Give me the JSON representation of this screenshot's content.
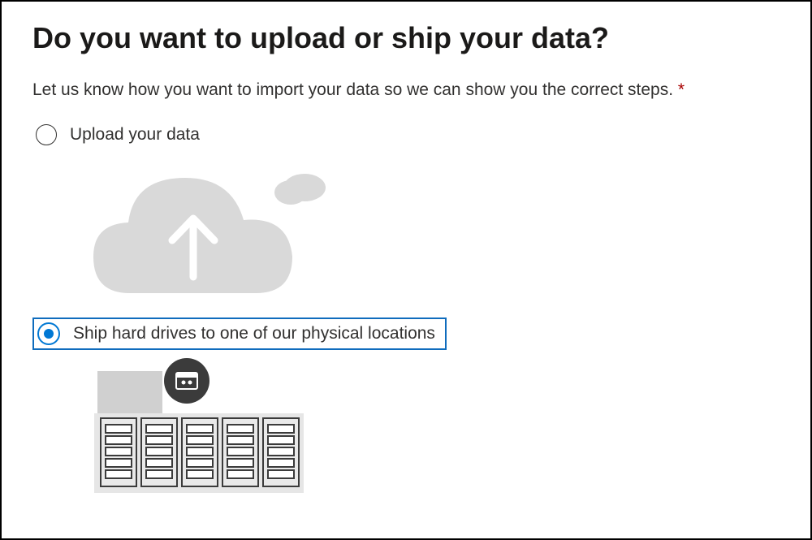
{
  "title": "Do you want to upload or ship your data?",
  "subtitle": "Let us know how you want to import your data so we can show you the correct steps.",
  "required_mark": "*",
  "options": {
    "upload": {
      "label": "Upload your data",
      "selected": false
    },
    "ship": {
      "label": "Ship hard drives to one of our physical locations",
      "selected": true
    }
  }
}
